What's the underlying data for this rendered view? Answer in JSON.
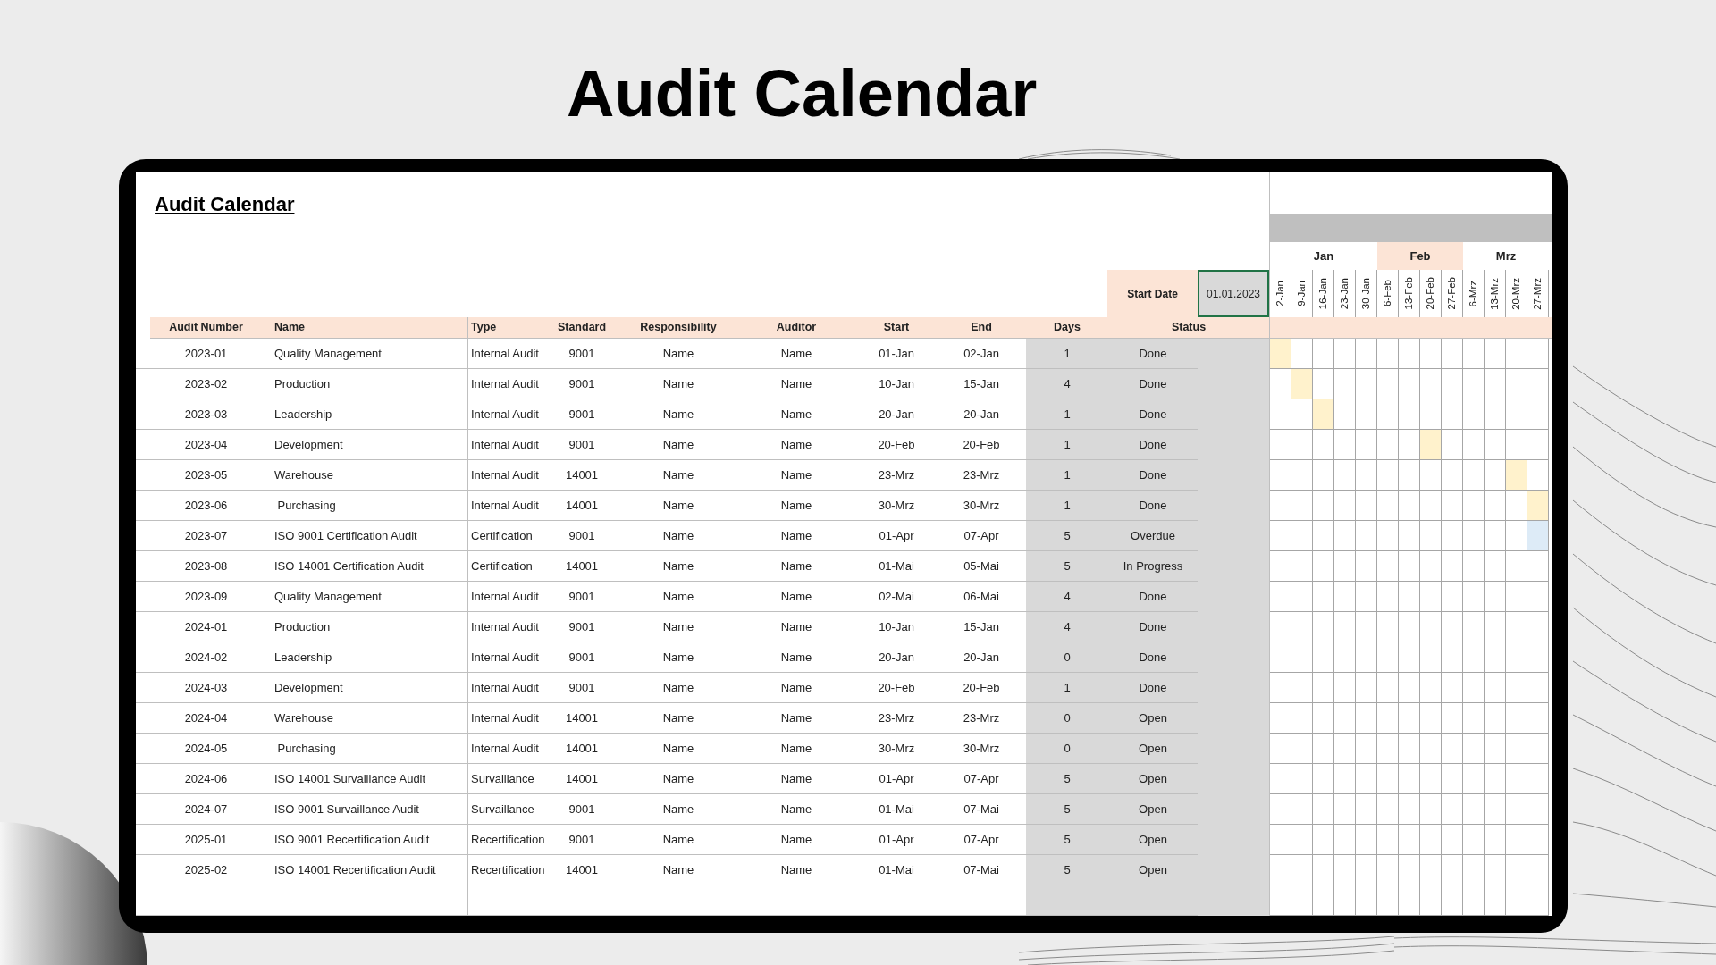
{
  "headline": "Audit Calendar",
  "sheet": {
    "title": "Audit Calendar",
    "start_date": {
      "label": "Start Date",
      "value": "01.01.2023"
    },
    "columns": [
      "Audit Number",
      "Name",
      "Type",
      "Standard",
      "Responsibility",
      "Auditor",
      "Start",
      "End",
      "Days",
      "Status"
    ],
    "rows": [
      {
        "number": "2023-01",
        "name": "Quality Management",
        "type": "Internal Audit",
        "standard": "9001",
        "responsibility": "Name",
        "auditor": "Name",
        "start": "01-Jan",
        "end": "02-Jan",
        "days": "1",
        "status": "Done",
        "color": "#fff2cc",
        "timeline": [
          true,
          false,
          false,
          false,
          false,
          false,
          false,
          false,
          false,
          false,
          false,
          false,
          false
        ]
      },
      {
        "number": "2023-02",
        "name": "Production",
        "type": "Internal Audit",
        "standard": "9001",
        "responsibility": "Name",
        "auditor": "Name",
        "start": "10-Jan",
        "end": "15-Jan",
        "days": "4",
        "status": "Done",
        "color": "#fff2cc",
        "timeline": [
          false,
          true,
          false,
          false,
          false,
          false,
          false,
          false,
          false,
          false,
          false,
          false,
          false
        ]
      },
      {
        "number": "2023-03",
        "name": "Leadership",
        "type": "Internal Audit",
        "standard": "9001",
        "responsibility": "Name",
        "auditor": "Name",
        "start": "20-Jan",
        "end": "20-Jan",
        "days": "1",
        "status": "Done",
        "color": "#fff2cc",
        "timeline": [
          false,
          false,
          true,
          false,
          false,
          false,
          false,
          false,
          false,
          false,
          false,
          false,
          false
        ]
      },
      {
        "number": "2023-04",
        "name": "Development",
        "type": "Internal Audit",
        "standard": "9001",
        "responsibility": "Name",
        "auditor": "Name",
        "start": "20-Feb",
        "end": "20-Feb",
        "days": "1",
        "status": "Done",
        "color": "#fff2cc",
        "timeline": [
          false,
          false,
          false,
          false,
          false,
          false,
          false,
          true,
          false,
          false,
          false,
          false,
          false
        ]
      },
      {
        "number": "2023-05",
        "name": "Warehouse",
        "type": "Internal Audit",
        "standard": "14001",
        "responsibility": "Name",
        "auditor": "Name",
        "start": "23-Mrz",
        "end": "23-Mrz",
        "days": "1",
        "status": "Done",
        "color": "#fff2cc",
        "timeline": [
          false,
          false,
          false,
          false,
          false,
          false,
          false,
          false,
          false,
          false,
          false,
          true,
          false
        ]
      },
      {
        "number": "2023-06",
        "name": " Purchasing",
        "type": "Internal Audit",
        "standard": "14001",
        "responsibility": "Name",
        "auditor": "Name",
        "start": "30-Mrz",
        "end": "30-Mrz",
        "days": "1",
        "status": "Done",
        "color": "#fff2cc",
        "timeline": [
          false,
          false,
          false,
          false,
          false,
          false,
          false,
          false,
          false,
          false,
          false,
          false,
          true
        ]
      },
      {
        "number": "2023-07",
        "name": "ISO 9001 Certification Audit",
        "type": "Certification",
        "standard": "9001",
        "responsibility": "Name",
        "auditor": "Name",
        "start": "01-Apr",
        "end": "07-Apr",
        "days": "5",
        "status": "Overdue",
        "color": "#ddebf7",
        "timeline": [
          false,
          false,
          false,
          false,
          false,
          false,
          false,
          false,
          false,
          false,
          false,
          false,
          true
        ]
      },
      {
        "number": "2023-08",
        "name": "ISO 14001 Certification Audit",
        "type": "Certification",
        "standard": "14001",
        "responsibility": "Name",
        "auditor": "Name",
        "start": "01-Mai",
        "end": "05-Mai",
        "days": "5",
        "status": "In Progress"
      },
      {
        "number": "2023-09",
        "name": "Quality Management",
        "type": "Internal Audit",
        "standard": "9001",
        "responsibility": "Name",
        "auditor": "Name",
        "start": "02-Mai",
        "end": "06-Mai",
        "days": "4",
        "status": "Done"
      },
      {
        "number": "2024-01",
        "name": "Production",
        "type": "Internal Audit",
        "standard": "9001",
        "responsibility": "Name",
        "auditor": "Name",
        "start": "10-Jan",
        "end": "15-Jan",
        "days": "4",
        "status": "Done"
      },
      {
        "number": "2024-02",
        "name": "Leadership",
        "type": "Internal Audit",
        "standard": "9001",
        "responsibility": "Name",
        "auditor": "Name",
        "start": "20-Jan",
        "end": "20-Jan",
        "days": "0",
        "status": "Done"
      },
      {
        "number": "2024-03",
        "name": "Development",
        "type": "Internal Audit",
        "standard": "9001",
        "responsibility": "Name",
        "auditor": "Name",
        "start": "20-Feb",
        "end": "20-Feb",
        "days": "1",
        "status": "Done"
      },
      {
        "number": "2024-04",
        "name": "Warehouse",
        "type": "Internal Audit",
        "standard": "14001",
        "responsibility": "Name",
        "auditor": "Name",
        "start": "23-Mrz",
        "end": "23-Mrz",
        "days": "0",
        "status": "Open"
      },
      {
        "number": "2024-05",
        "name": " Purchasing",
        "type": "Internal Audit",
        "standard": "14001",
        "responsibility": "Name",
        "auditor": "Name",
        "start": "30-Mrz",
        "end": "30-Mrz",
        "days": "0",
        "status": "Open"
      },
      {
        "number": "2024-06",
        "name": "ISO 14001 Survaillance Audit",
        "type": "Survaillance",
        "standard": "14001",
        "responsibility": "Name",
        "auditor": "Name",
        "start": "01-Apr",
        "end": "07-Apr",
        "days": "5",
        "status": "Open"
      },
      {
        "number": "2024-07",
        "name": "ISO 9001 Survaillance Audit",
        "type": "Survaillance",
        "standard": "9001",
        "responsibility": "Name",
        "auditor": "Name",
        "start": "01-Mai",
        "end": "07-Mai",
        "days": "5",
        "status": "Open"
      },
      {
        "number": "2025-01",
        "name": "ISO 9001 Recertification Audit",
        "type": "Recertification",
        "standard": "9001",
        "responsibility": "Name",
        "auditor": "Name",
        "start": "01-Apr",
        "end": "07-Apr",
        "days": "5",
        "status": "Open"
      },
      {
        "number": "2025-02",
        "name": "ISO 14001 Recertification Audit",
        "type": "Recertification",
        "standard": "14001",
        "responsibility": "Name",
        "auditor": "Name",
        "start": "01-Mai",
        "end": "07-Mai",
        "days": "5",
        "status": "Open"
      }
    ]
  },
  "timeline": {
    "months": [
      {
        "label": "Jan",
        "shaded": false,
        "weeks": [
          "2-Jan",
          "9-Jan",
          "16-Jan",
          "23-Jan",
          "30-Jan"
        ]
      },
      {
        "label": "Feb",
        "shaded": true,
        "weeks": [
          "6-Feb",
          "13-Feb",
          "20-Feb",
          "27-Feb"
        ]
      },
      {
        "label": "Mrz",
        "shaded": false,
        "weeks": [
          "6-Mrz",
          "13-Mrz",
          "20-Mrz",
          "27-Mrz"
        ]
      }
    ]
  }
}
